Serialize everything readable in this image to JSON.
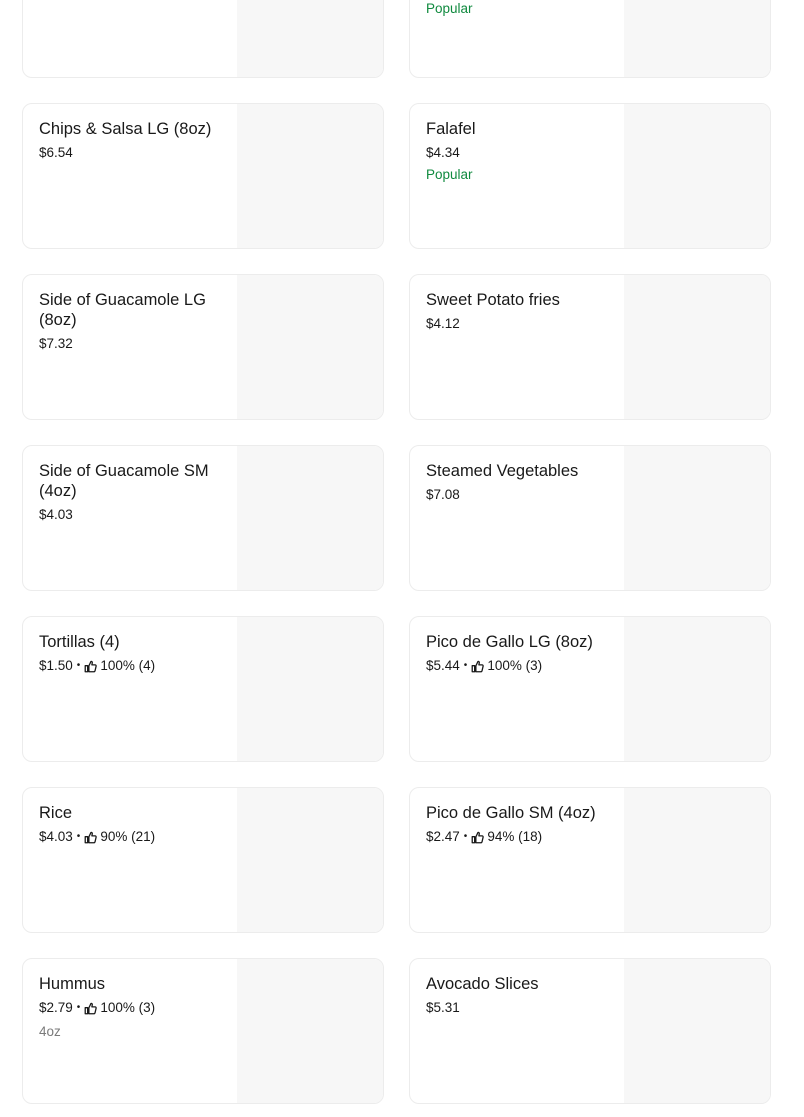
{
  "menu": {
    "items": [
      {
        "name": "",
        "price": "",
        "popular": ""
      },
      {
        "name": "",
        "price": "",
        "popular": "Popular"
      },
      {
        "name": "Chips & Salsa LG (8oz)",
        "price": "$6.54"
      },
      {
        "name": "Falafel",
        "price": "$4.34",
        "popular": "Popular"
      },
      {
        "name": "Side of Guacamole LG (8oz)",
        "price": "$7.32"
      },
      {
        "name": "Sweet Potato fries",
        "price": "$4.12"
      },
      {
        "name": "Side of Guacamole SM (4oz)",
        "price": "$4.03"
      },
      {
        "name": "Steamed Vegetables",
        "price": "$7.08"
      },
      {
        "name": "Tortillas (4)",
        "price": "$1.50",
        "rating": "100% (4)"
      },
      {
        "name": "Pico de Gallo LG (8oz)",
        "price": "$5.44",
        "rating": "100% (3)"
      },
      {
        "name": "Rice",
        "price": "$4.03",
        "rating": "90% (21)"
      },
      {
        "name": "Pico de Gallo SM (4oz)",
        "price": "$2.47",
        "rating": "94% (18)"
      },
      {
        "name": "Hummus",
        "price": "$2.79",
        "rating": "100% (3)",
        "note": "4oz"
      },
      {
        "name": "Avocado Slices",
        "price": "$5.31"
      }
    ]
  },
  "icons": {
    "rating": "thumbs-up-icon"
  },
  "colors": {
    "popular": "#108a3f",
    "card_border": "#ececec",
    "image_placeholder": "#f7f7f7",
    "note": "#7a7a7a"
  }
}
